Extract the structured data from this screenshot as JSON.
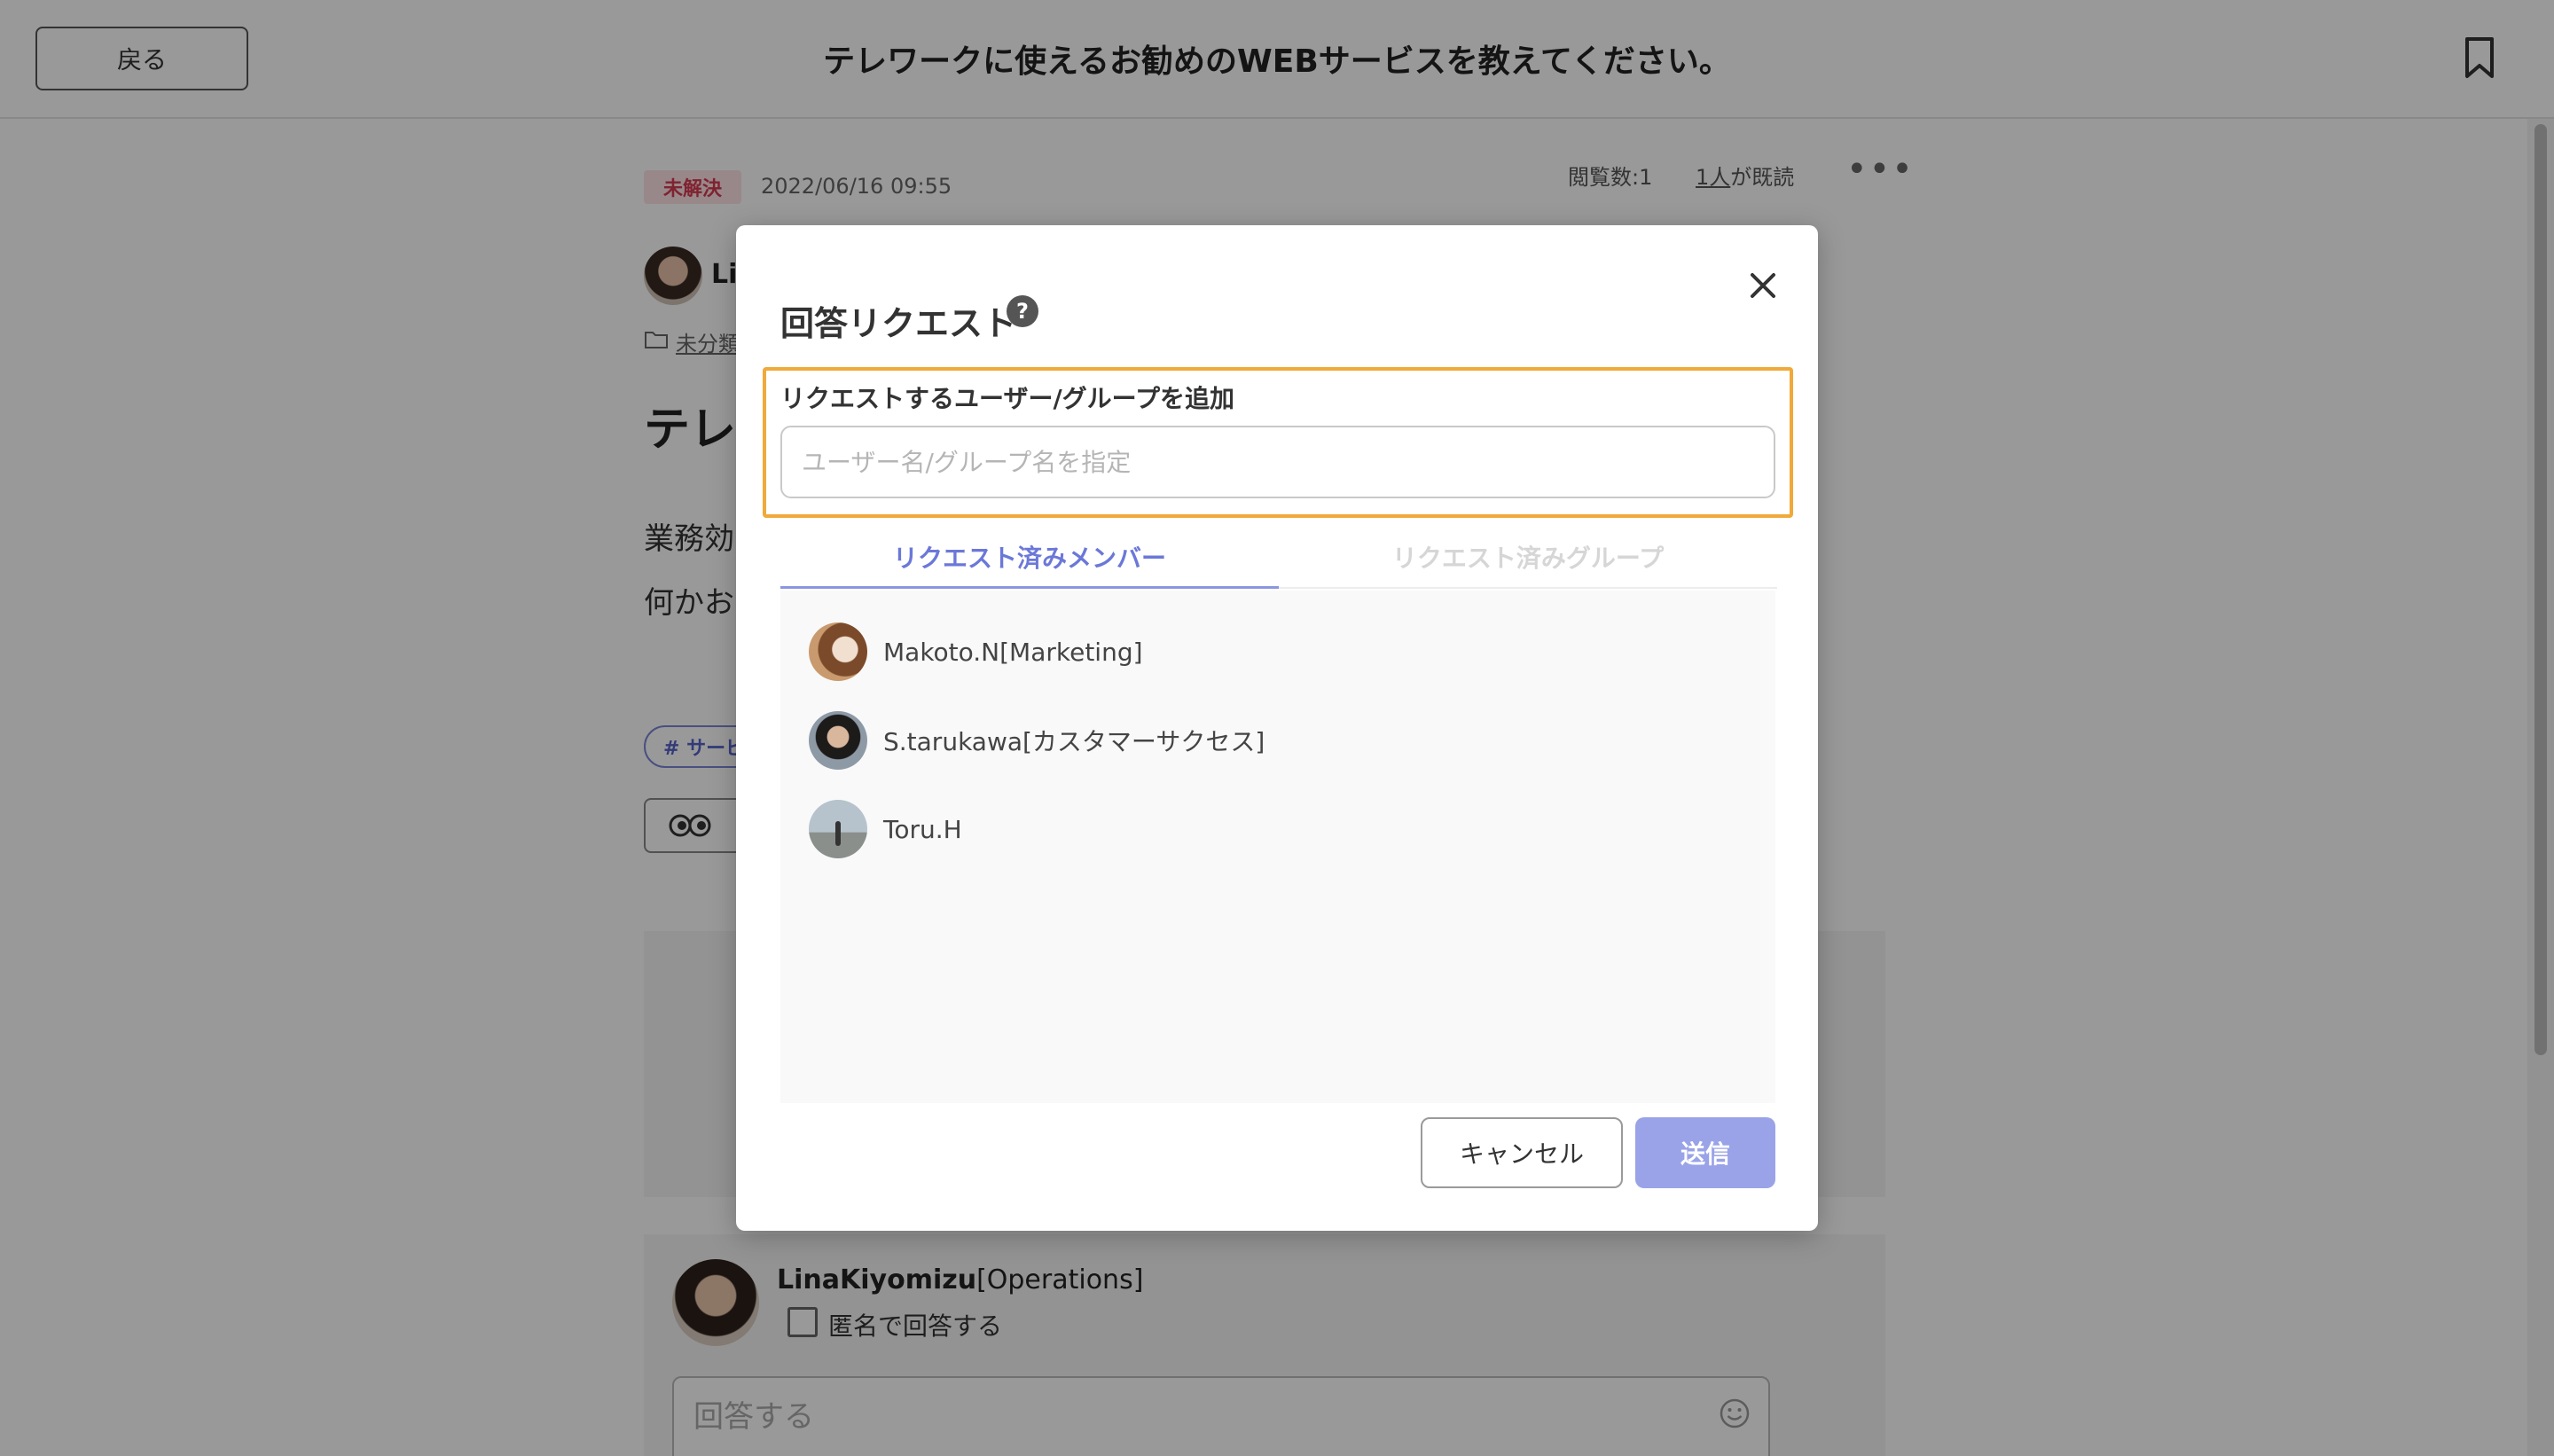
{
  "header": {
    "back_label": "戻る",
    "title": "テレワークに使えるお勧めのWEBサービスを教えてください。"
  },
  "post": {
    "status": "未解決",
    "date": "2022/06/16 09:55",
    "views": "閲覧数:1",
    "read_count_link": "1人",
    "read_count_suffix": "が既読",
    "author_partial": "Li",
    "category_partial": "未分類",
    "heading_partial": "テレワ",
    "body_line1_partial": "業務効",
    "body_line2_partial": "何かお",
    "tag_partial": "# サービ"
  },
  "composer": {
    "user_name": "LinaKiyomizu",
    "user_dept": "[Operations]",
    "anonymous_label": "匿名で回答する",
    "reply_placeholder": "回答する"
  },
  "modal": {
    "title": "回答リクエスト",
    "add_label": "リクエストするユーザー/グループを追加",
    "search_placeholder": "ユーザー名/グループ名を指定",
    "tabs": [
      {
        "label": "リクエスト済みメンバー",
        "active": true
      },
      {
        "label": "リクエスト済みグループ",
        "active": false
      }
    ],
    "members": [
      {
        "name": "Makoto.N[Marketing]"
      },
      {
        "name": "S.tarukawa[カスタマーサクセス]"
      },
      {
        "name": "Toru.H"
      }
    ],
    "cancel_label": "キャンセル",
    "submit_label": "送信"
  },
  "colors": {
    "accent": "#6b78d8",
    "submit_bg": "#9aa3e8",
    "highlight": "#f0a93a",
    "status_red": "#d63a51"
  },
  "icons": [
    "bookmark-icon",
    "more-icon",
    "folder-icon",
    "help-icon",
    "close-icon",
    "eyes-icon",
    "smile-icon"
  ]
}
